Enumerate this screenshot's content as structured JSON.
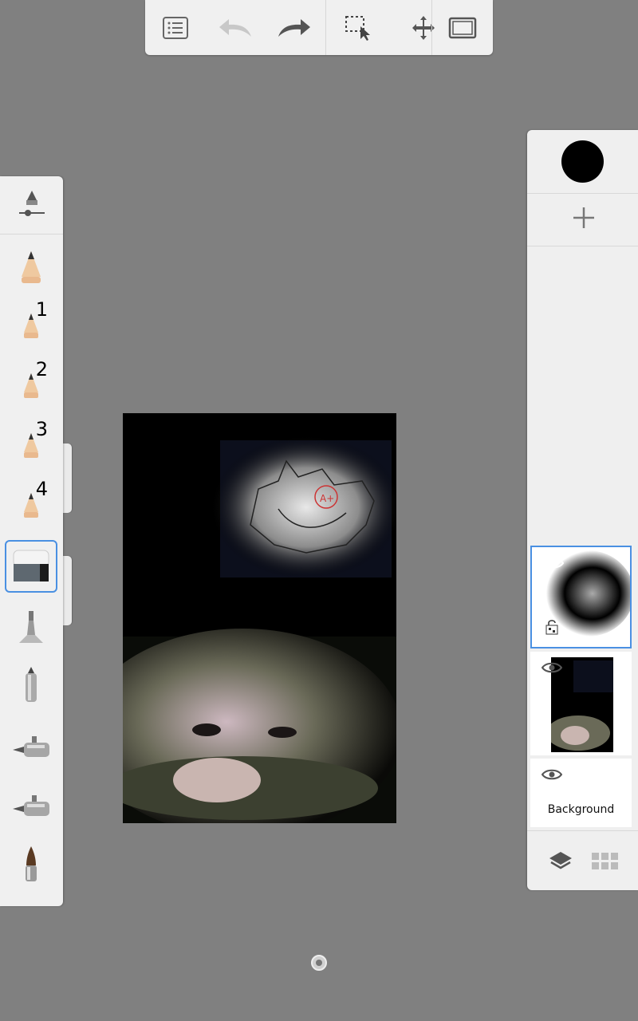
{
  "toolbar": {
    "icons": [
      "list-icon",
      "undo-icon",
      "redo-icon",
      "selection-icon",
      "move-icon",
      "fullscreen-icon"
    ]
  },
  "brushes": {
    "header_icon": "brush-size-slider-icon",
    "items": [
      {
        "icon": "pencil-icon",
        "label": ""
      },
      {
        "icon": "pencil-1-icon",
        "label": "1"
      },
      {
        "icon": "pencil-2-icon",
        "label": "2"
      },
      {
        "icon": "pencil-3-icon",
        "label": "3"
      },
      {
        "icon": "pencil-4-icon",
        "label": "4"
      },
      {
        "icon": "eraser-icon",
        "label": "",
        "selected": true
      },
      {
        "icon": "airbrush-icon",
        "label": ""
      },
      {
        "icon": "marker-icon",
        "label": ""
      },
      {
        "icon": "smear-icon",
        "label": ""
      },
      {
        "icon": "blur-icon",
        "label": ""
      },
      {
        "icon": "paintbrush-icon",
        "label": ""
      }
    ]
  },
  "colors": {
    "current_brush_color": "#000000",
    "accent": "#4a90e2",
    "background": "#808080"
  },
  "layers": {
    "add_label": "+",
    "items": [
      {
        "name": "layer-1",
        "active": true
      },
      {
        "name": "layer-2",
        "active": false
      },
      {
        "name": "background",
        "label": "Background",
        "active": false
      }
    ],
    "bottom_icons": [
      "layers-icon",
      "grid-icon"
    ]
  }
}
